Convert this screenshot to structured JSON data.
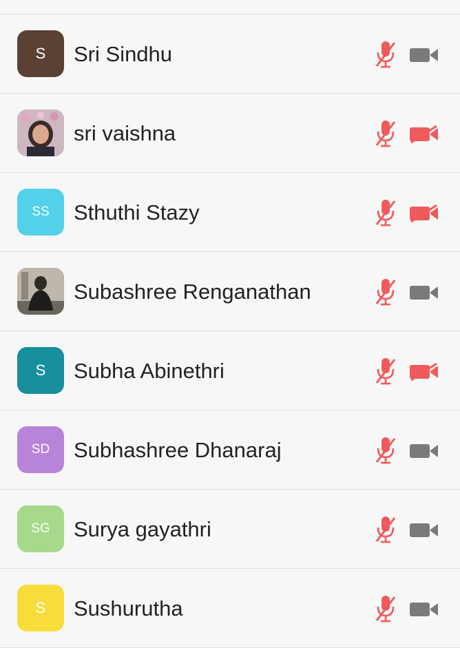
{
  "participants": [
    {
      "name": "Sri Sindhu",
      "initials": "S",
      "avatar_type": "initials",
      "avatar_color": "#5b4034",
      "mic": "muted",
      "video": "off-gray"
    },
    {
      "name": "sri vaishna",
      "initials": "",
      "avatar_type": "photo",
      "avatar_color": "#8a5a6a",
      "mic": "muted",
      "video": "off-red"
    },
    {
      "name": "Sthuthi Stazy",
      "initials": "SS",
      "avatar_type": "initials",
      "avatar_color": "#52d1e8",
      "mic": "muted",
      "video": "off-red"
    },
    {
      "name": "Subashree Renganathan",
      "initials": "",
      "avatar_type": "photo",
      "avatar_color": "#4a4a4a",
      "mic": "muted",
      "video": "off-gray"
    },
    {
      "name": "Subha Abinethri",
      "initials": "S",
      "avatar_type": "initials",
      "avatar_color": "#178f9c",
      "mic": "muted",
      "video": "off-red"
    },
    {
      "name": "Subhashree Dhanaraj",
      "initials": "SD",
      "avatar_type": "initials",
      "avatar_color": "#b884da",
      "mic": "muted",
      "video": "off-gray"
    },
    {
      "name": "Surya gayathri",
      "initials": "SG",
      "avatar_type": "initials",
      "avatar_color": "#a6d98a",
      "mic": "muted",
      "video": "off-gray"
    },
    {
      "name": "Sushurutha",
      "initials": "S",
      "avatar_type": "initials",
      "avatar_color": "#f7dd3c",
      "mic": "muted",
      "video": "off-gray"
    }
  ],
  "colors": {
    "muted_red": "#f05a5a",
    "video_gray": "#7a7a7a",
    "text": "#222222",
    "divider": "#dedede"
  },
  "icons": {
    "mic": "mic-muted-icon",
    "camera": "video-camera-icon"
  }
}
